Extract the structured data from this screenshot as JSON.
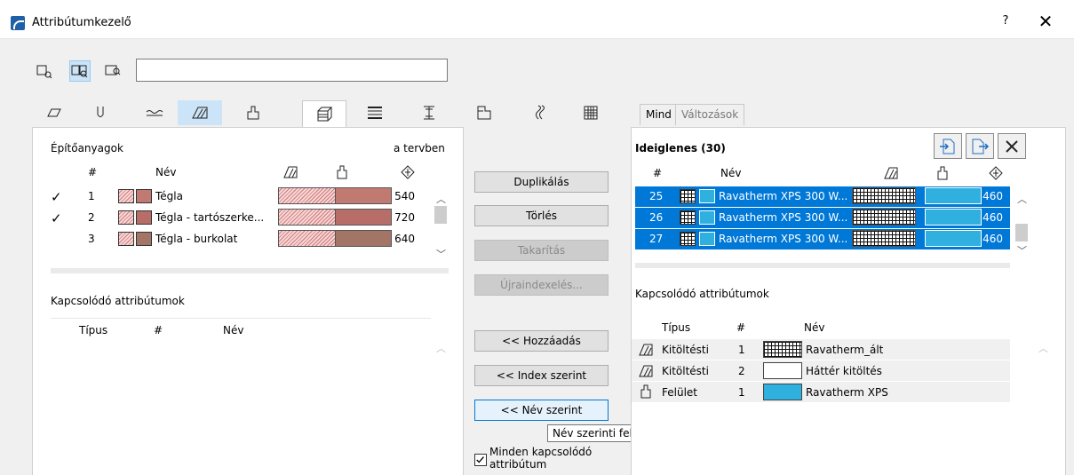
{
  "window": {
    "title": "Attribútumkezelő",
    "help_label": "?",
    "close_label": "✕"
  },
  "search": {
    "value": "",
    "placeholder": ""
  },
  "text_tabs": {
    "all": "Mind",
    "changes": "Változások"
  },
  "left": {
    "title": "Építőanyagok",
    "scope": "a tervben",
    "columns": {
      "index": "#",
      "name": "Név"
    },
    "rows": [
      {
        "check": "✓",
        "index": "1",
        "name": "Tégla",
        "value": "540"
      },
      {
        "check": "✓",
        "index": "2",
        "name": "Tégla - tartószerke...",
        "value": "720"
      },
      {
        "check": "",
        "index": "3",
        "name": "Tégla - burkolat",
        "value": "640"
      }
    ],
    "related_title": "Kapcsolódó attribútumok",
    "related_columns": {
      "type": "Típus",
      "index": "#",
      "name": "Név"
    }
  },
  "buttons": {
    "duplicate": "Duplikálás",
    "delete": "Törlés",
    "purge": "Takarítás",
    "reindex": "Újraindexelés...",
    "add": "<< Hozzáadás",
    "by_index": "<< Index szerint",
    "by_name": "<< Név szerint",
    "tooltip": "Név szerinti felülírás",
    "all_related_checkbox": "Minden kapcsolódó attribútum"
  },
  "right": {
    "title": "Ideiglenes (30)",
    "columns": {
      "index": "#",
      "name": "Név"
    },
    "rows": [
      {
        "index": "25",
        "name": "Ravatherm XPS 300 W...",
        "value": "460"
      },
      {
        "index": "26",
        "name": "Ravatherm XPS 300 W...",
        "value": "460"
      },
      {
        "index": "27",
        "name": "Ravatherm XPS 300 W...",
        "value": "460"
      }
    ],
    "related_title": "Kapcsolódó attribútumok",
    "related_columns": {
      "type": "Típus",
      "index": "#",
      "name": "Név"
    },
    "related_rows": [
      {
        "type": "Kitöltésti",
        "index": "1",
        "name": "Ravatherm_ált"
      },
      {
        "type": "Kitöltésti",
        "index": "2",
        "name": "Háttér kitöltés"
      },
      {
        "type": "Felület",
        "index": "1",
        "name": "Ravatherm XPS"
      }
    ]
  },
  "colors": {
    "selection": "#0078d7",
    "highlight": "#cce4f7",
    "cyan": "#2fb0de"
  }
}
